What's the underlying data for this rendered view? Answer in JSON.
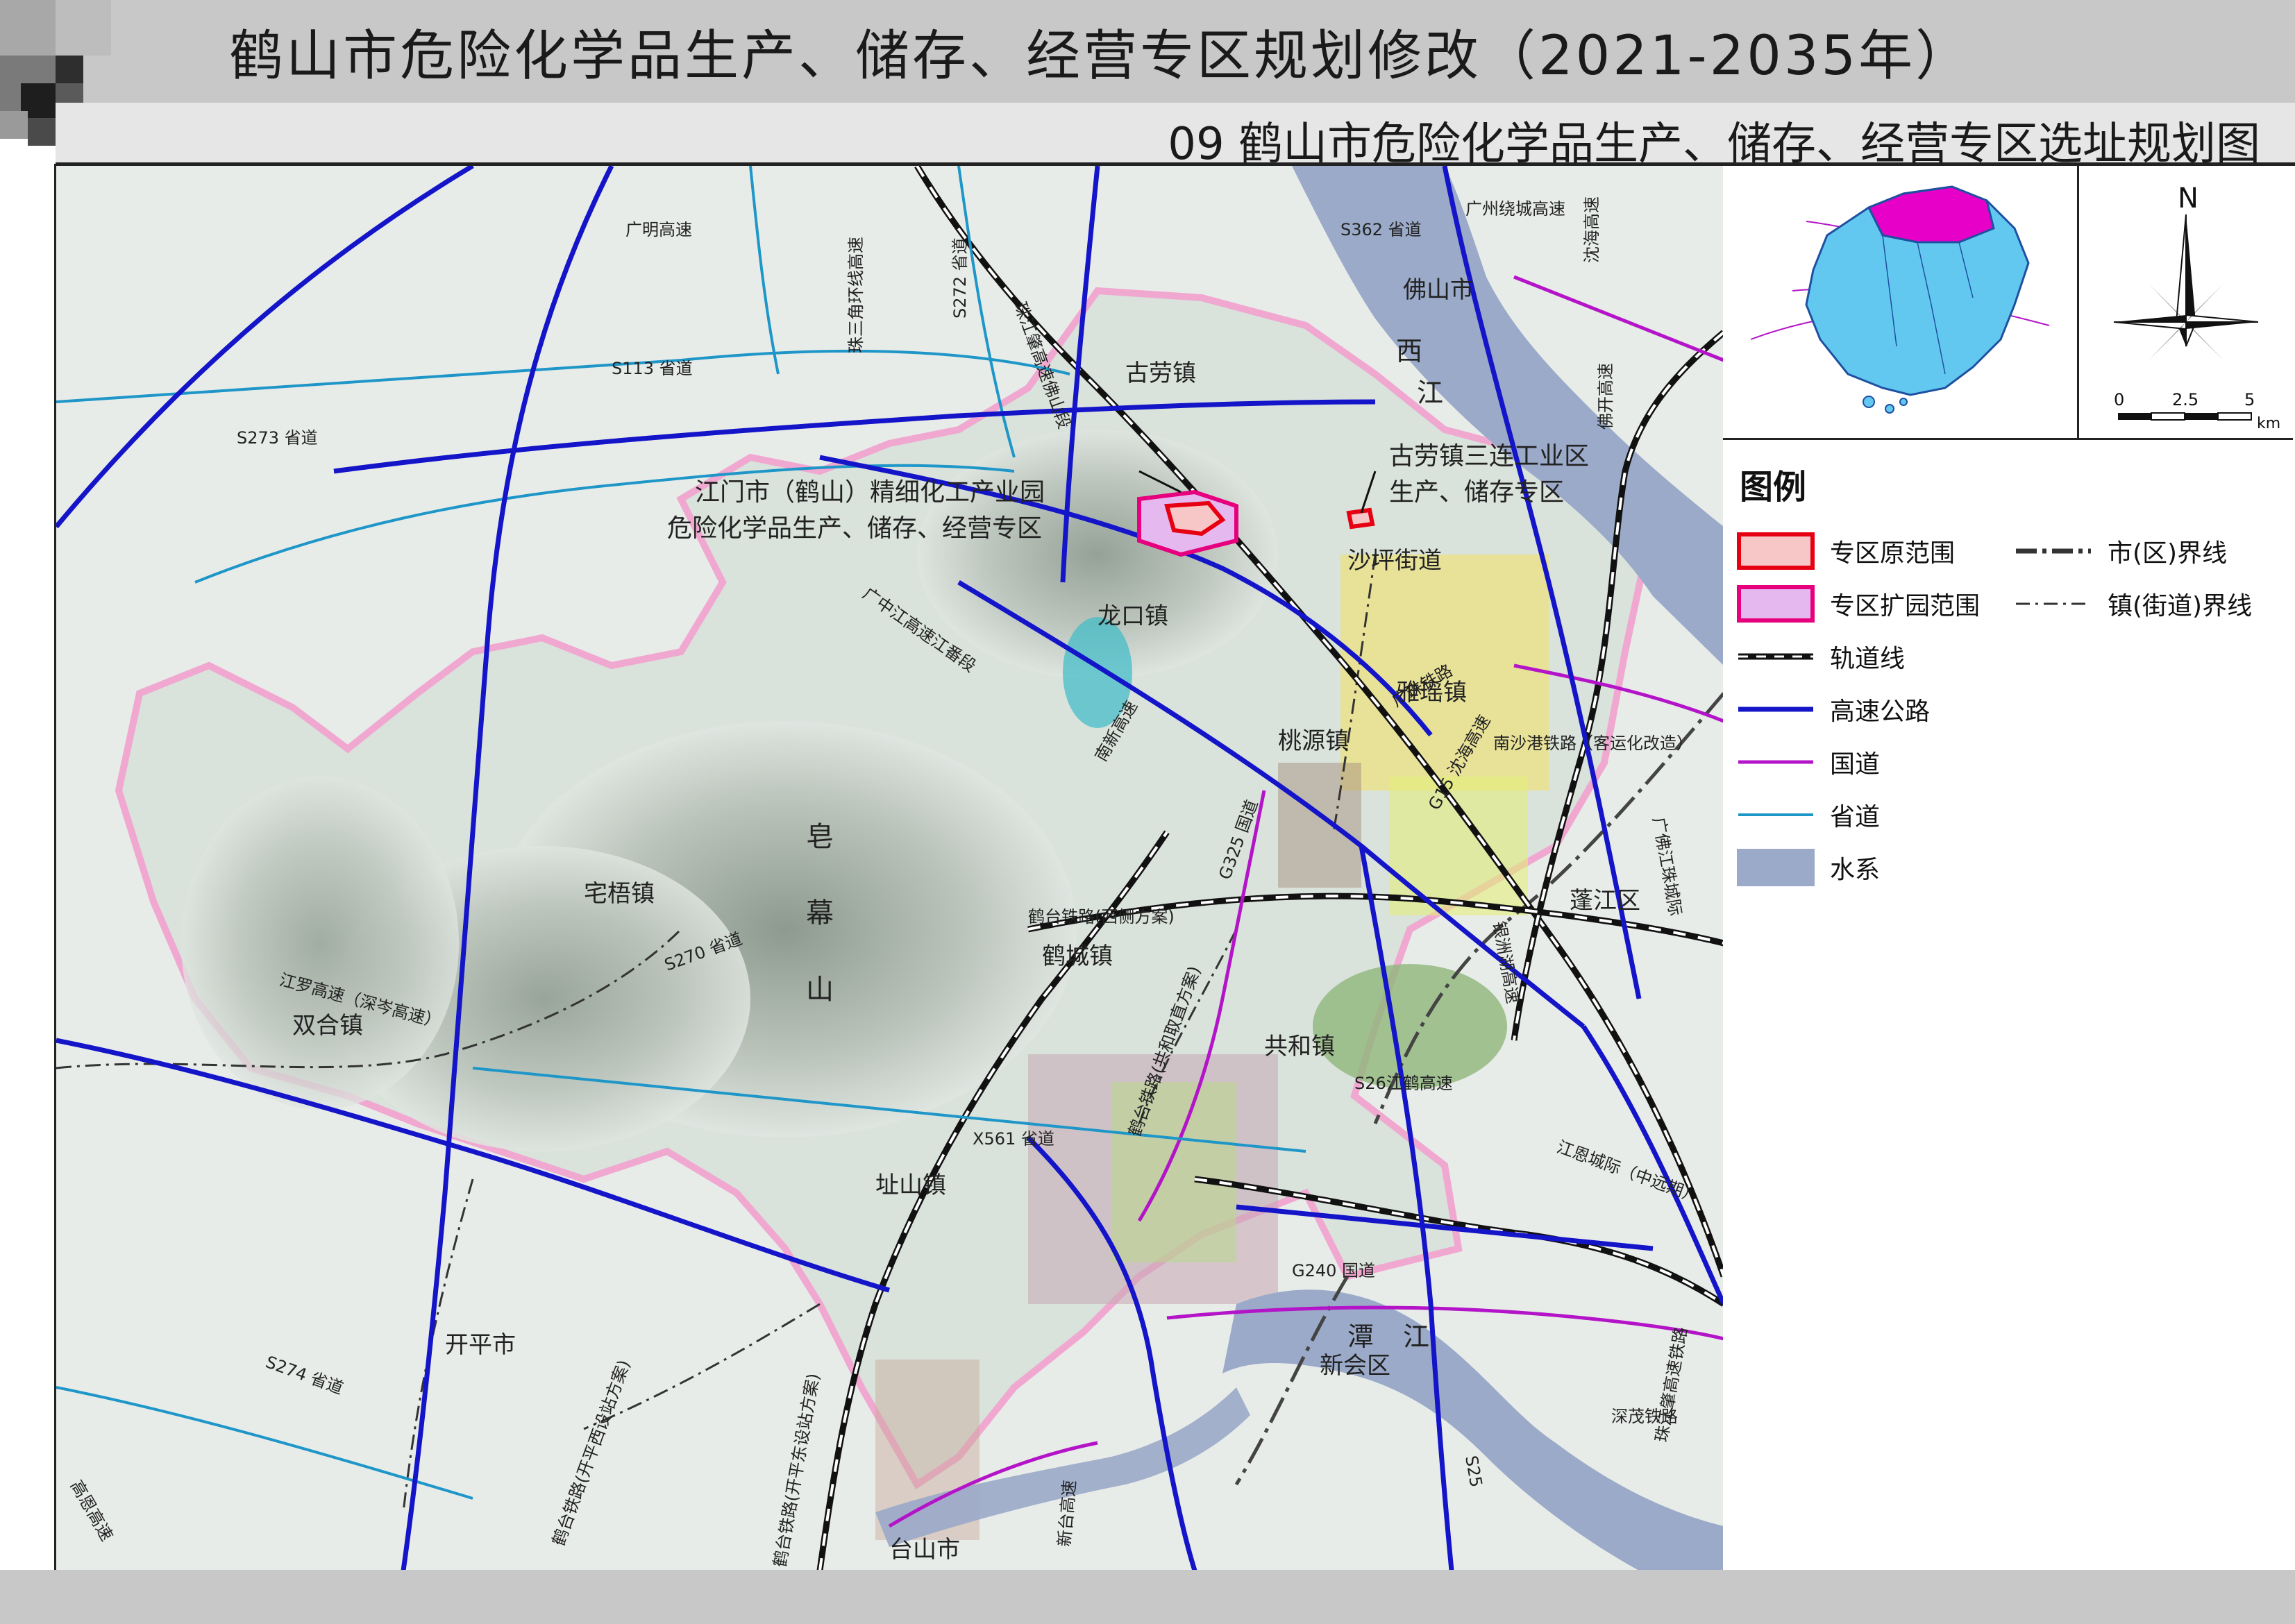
{
  "title": "鹤山市危险化学品生产、储存、经营专区规划修改（2021-2035年）",
  "subtitle": "09 鹤山市危险化学品生产、储存、经营专区选址规划图",
  "legend": {
    "heading": "图例",
    "items": [
      {
        "key": "orig",
        "label": "专区原范围",
        "fill": "#f7c6c6",
        "stroke": "#e60012"
      },
      {
        "key": "ext",
        "label": "专区扩园范围",
        "fill": "#e6b8f0",
        "stroke": "#e6007e"
      },
      {
        "key": "rail",
        "label": "轨道线"
      },
      {
        "key": "expressway",
        "label": "高速公路",
        "stroke": "#1414c8"
      },
      {
        "key": "national",
        "label": "国道",
        "stroke": "#b414c8"
      },
      {
        "key": "provincial",
        "label": "省道",
        "stroke": "#1e96c8"
      },
      {
        "key": "water",
        "label": "水系",
        "fill": "#9aaac8"
      },
      {
        "key": "city_boundary",
        "label": "市(区)界线"
      },
      {
        "key": "town_boundary",
        "label": "镇(街道)界线"
      }
    ]
  },
  "north_arrow": {
    "label": "N"
  },
  "scale_bar": {
    "ticks": [
      "0",
      "2.5",
      "5"
    ],
    "unit": "km"
  },
  "map": {
    "place_labels": {
      "foshan": "佛山市",
      "gulao": "古劳镇",
      "longkou": "龙口镇",
      "shaping": "沙坪街道",
      "yayao": "雅瑶镇",
      "taoyuan": "桃源镇",
      "pengjiang": "蓬江区",
      "hecheng": "鹤城镇",
      "gonghe": "共和镇",
      "zhaiwu": "宅梧镇",
      "shuanghe": "双合镇",
      "zhishan": "址山镇",
      "kaiping": "开平市",
      "xinhui": "新会区",
      "taishan": "台山市"
    },
    "zone_labels": {
      "jiangmen_line1": "江门市（鹤山）精细化工产业园",
      "jiangmen_line2": "危险化学品生产、储存、经营专区",
      "sanlian_line1": "古劳镇三连工业区",
      "sanlian_line2": "生产、储存专区"
    },
    "water_labels": {
      "xi": "西",
      "jiang": "江",
      "tan": "潭",
      "tan_jiang": "江"
    },
    "mountain_labels": {
      "zao": "皂",
      "mu": "幕",
      "shan": "山"
    },
    "road_labels": {
      "guangming": "广明高速",
      "zhusanjiao": "珠三角环线高速",
      "s272": "S272 省道",
      "zhujiang": "珠江肇高速佛山段",
      "s362": "S362 省道",
      "guangzhou_ring": "广州绕城高速",
      "shenhai": "沈海高速",
      "s113": "S113 省道",
      "foshan_kaiping": "佛开高速",
      "s273": "S273 省道",
      "guangzhong": "广中江高速江番段",
      "nanxin": "南新高速",
      "guangzhu_rail": "广珠铁路",
      "nansha_rail": "南沙港铁路（客运化改造）",
      "g15": "G15 沈海高速",
      "g325": "G325 国道",
      "hetai_west": "鹤台铁路(西侧方案)",
      "guangfo_rail": "广佛江珠城际",
      "s270": "S270 省道",
      "jiangluo": "江罗高速（深岑高速）",
      "yinzhouhu": "银洲湖高速",
      "gonghe_ring": "鹤台铁路(共和取直方案)",
      "s26": "S26江鹤高速",
      "x561": "X561 省道",
      "jiangen": "江恩城际（中远期）",
      "g240": "G240 国道",
      "s274": "S274 省道",
      "kaiping_west": "鹤台铁路(开平西设站方案)",
      "kaiping_east": "鹤台铁路(开平东设站方案)",
      "xintai": "新台高速",
      "shenmao": "深茂铁路",
      "zhujiang_rail": "珠江肇高速铁路",
      "s25": "S25",
      "gaoen": "高恩高速"
    }
  }
}
